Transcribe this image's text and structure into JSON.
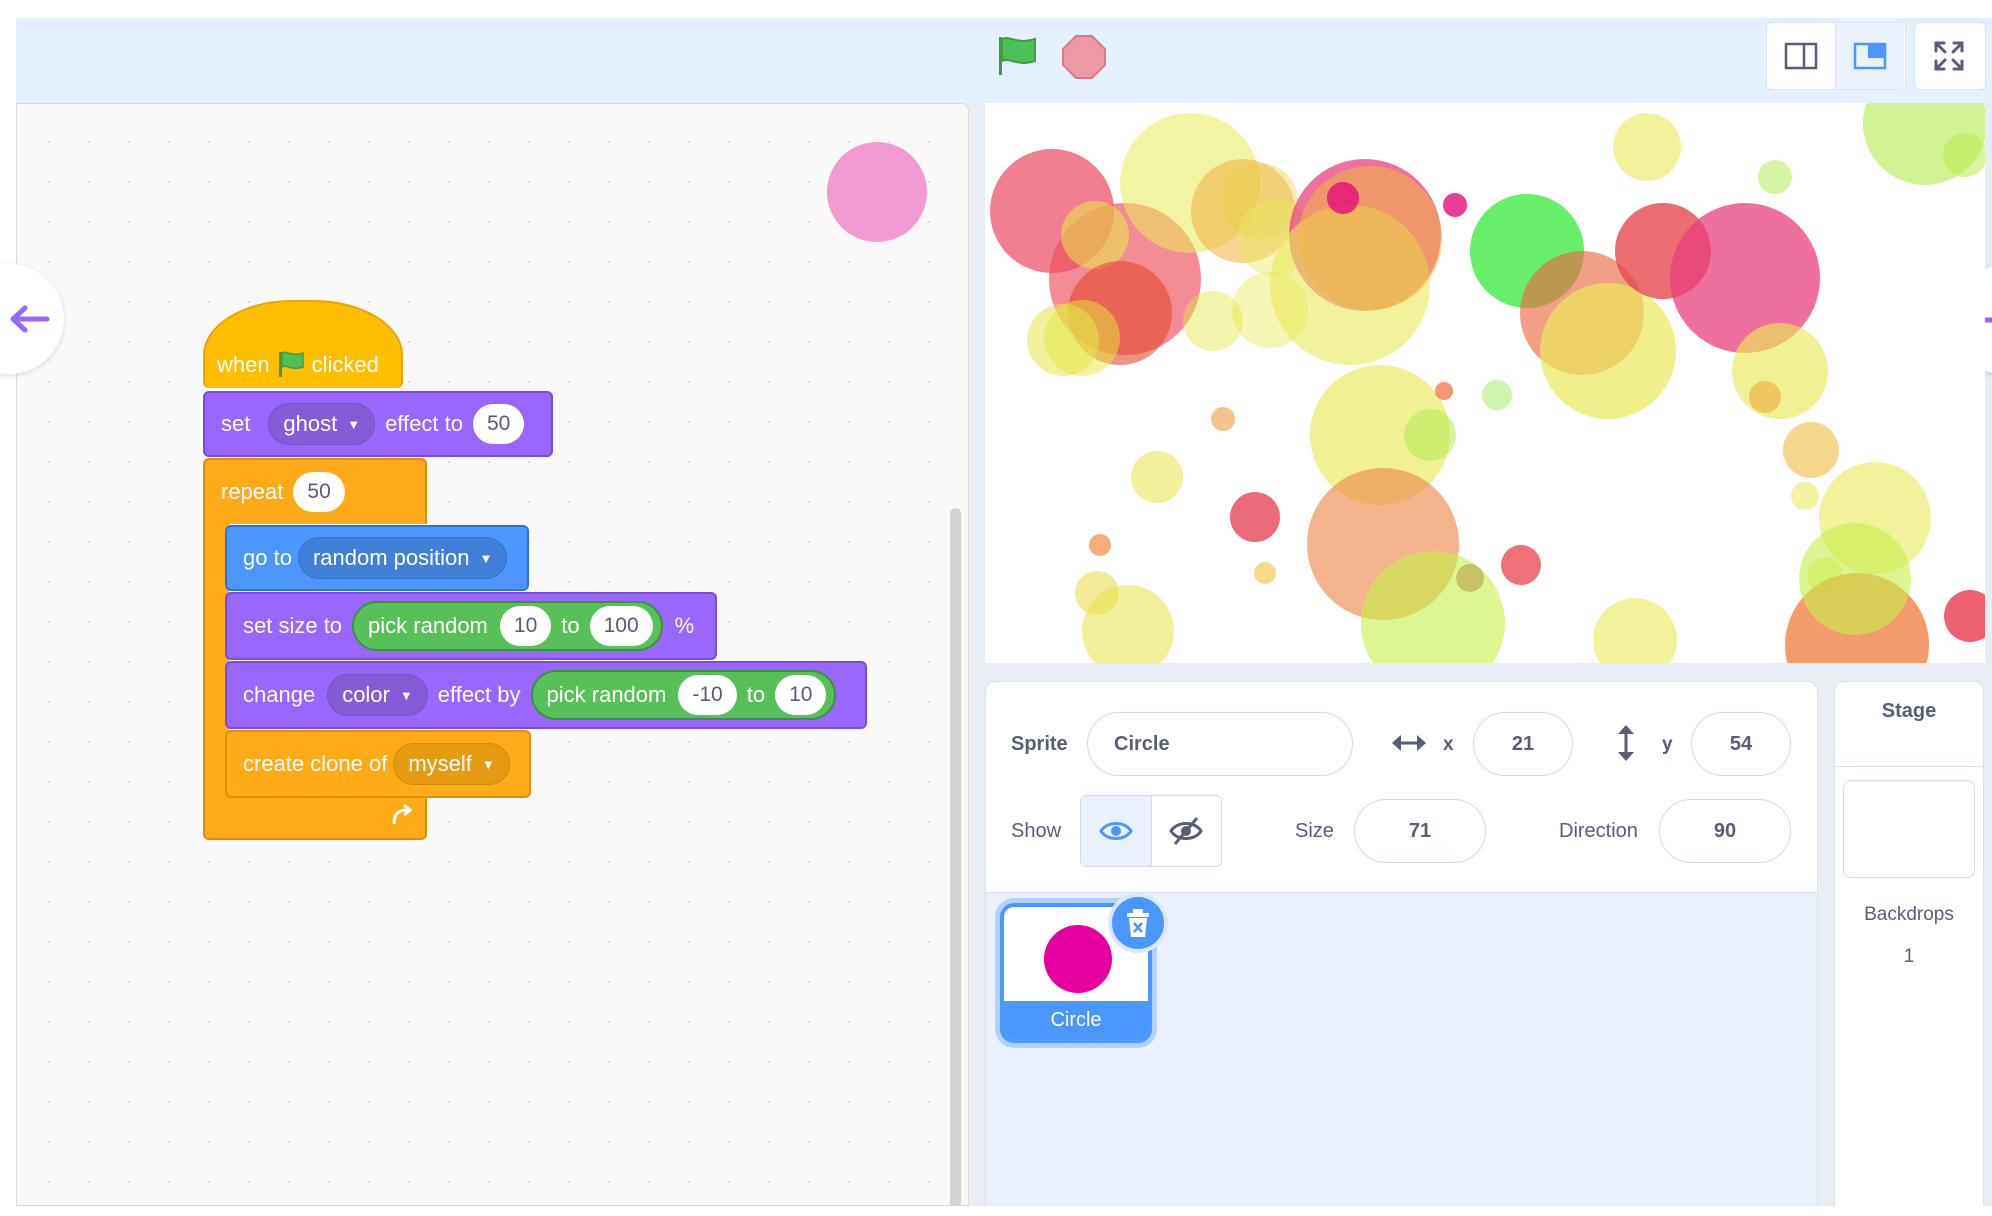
{
  "header": {
    "green_flag_icon": "green-flag-icon",
    "stop_icon": "stop-icon",
    "layout_buttons": [
      "small-stage-icon",
      "normal-stage-icon",
      "fullscreen-icon"
    ]
  },
  "script": {
    "hat": {
      "when": "when",
      "clicked": "clicked"
    },
    "set_effect": {
      "set": "set",
      "effect_menu": "ghost",
      "effect_to": "effect to",
      "value": "50"
    },
    "repeat": {
      "label": "repeat",
      "count": "50"
    },
    "goto": {
      "label": "go to",
      "target": "random position"
    },
    "set_size": {
      "label": "set size to",
      "random": "pick random",
      "from": "10",
      "to_word": "to",
      "to": "100",
      "percent": "%"
    },
    "change_effect": {
      "label": "change",
      "effect_menu": "color",
      "effect_by": "effect by",
      "random": "pick random",
      "from": "-10",
      "to_word": "to",
      "to": "10"
    },
    "clone": {
      "label": "create clone of",
      "target": "myself"
    }
  },
  "sprite_info": {
    "sprite_label": "Sprite",
    "sprite_name": "Circle",
    "x_label": "x",
    "x_value": "21",
    "y_label": "y",
    "y_value": "54",
    "show_label": "Show",
    "size_label": "Size",
    "size_value": "71",
    "direction_label": "Direction",
    "direction_value": "90"
  },
  "sprite_tile": {
    "name": "Circle"
  },
  "stage_panel": {
    "title": "Stage",
    "backdrops_label": "Backdrops",
    "backdrops_count": "1"
  },
  "colors": {
    "events": "#ffbf00",
    "looks": "#9966ff",
    "control": "#ffab19",
    "motion": "#4c97ff",
    "operators": "#59c059",
    "sprite_costume": "#e6009e"
  }
}
